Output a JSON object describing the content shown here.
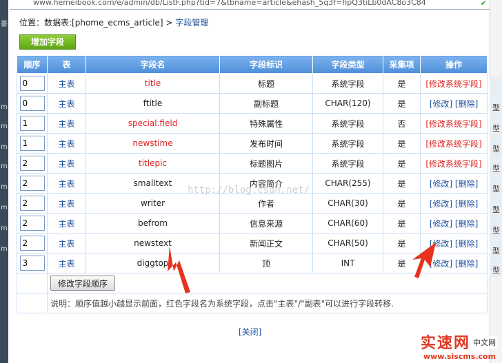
{
  "address_bar": {
    "url": "www.hemeibook.com/e/admin/db/ListF.php?tid=7&tbname=article&ehash_5q3f=fipQ3tiLb0dAC8o3C84",
    "secure_icon": "check-shield-icon"
  },
  "breadcrumb": {
    "prefix": "位置：数据表:[phome_ecms_article] >",
    "current": "字段管理"
  },
  "add_field_button": "增加字段",
  "table": {
    "headers": [
      "顺序",
      "表",
      "字段名",
      "字段标识",
      "字段类型",
      "采集项",
      "操作"
    ],
    "rows": [
      {
        "order": "0",
        "table": "主表",
        "field": "title",
        "label": "标题",
        "type": "系统字段",
        "collect": "是",
        "actions": [
          "[修改系统字段]"
        ],
        "system": true
      },
      {
        "order": "0",
        "table": "主表",
        "field": "ftitle",
        "label": "副标题",
        "type": "CHAR(120)",
        "collect": "是",
        "actions": [
          "[修改]",
          "[删除]"
        ],
        "system": false
      },
      {
        "order": "1",
        "table": "主表",
        "field": "special.field",
        "label": "特殊属性",
        "type": "系统字段",
        "collect": "否",
        "actions": [
          "[修改系统字段]"
        ],
        "system": true
      },
      {
        "order": "1",
        "table": "主表",
        "field": "newstime",
        "label": "发布时间",
        "type": "系统字段",
        "collect": "是",
        "actions": [
          "[修改系统字段]"
        ],
        "system": true
      },
      {
        "order": "2",
        "table": "主表",
        "field": "titlepic",
        "label": "标题图片",
        "type": "系统字段",
        "collect": "是",
        "actions": [
          "[修改系统字段]"
        ],
        "system": true
      },
      {
        "order": "2",
        "table": "主表",
        "field": "smalltext",
        "label": "内容简介",
        "type": "CHAR(255)",
        "collect": "是",
        "actions": [
          "[修改]",
          "[删除]"
        ],
        "system": false
      },
      {
        "order": "2",
        "table": "主表",
        "field": "writer",
        "label": "作者",
        "type": "CHAR(30)",
        "collect": "是",
        "actions": [
          "[修改]",
          "[删除]"
        ],
        "system": false
      },
      {
        "order": "2",
        "table": "主表",
        "field": "befrom",
        "label": "信息来源",
        "type": "CHAR(60)",
        "collect": "是",
        "actions": [
          "[修改]",
          "[删除]"
        ],
        "system": false
      },
      {
        "order": "2",
        "table": "主表",
        "field": "newstext",
        "label": "新闻正文",
        "type": "CHAR(50)",
        "collect": "是",
        "actions": [
          "[修改]",
          "[删除]"
        ],
        "system": false
      },
      {
        "order": "3",
        "table": "主表",
        "field": "diggtop",
        "label": "顶",
        "type": "INT",
        "collect": "是",
        "actions": [
          "[修改]",
          "[删除]"
        ],
        "system": false
      }
    ]
  },
  "modify_order_button": "修改字段顺序",
  "note": "说明：顺序值越小越显示前面，红色字段名为系统字段，点击\"主表\"/\"副表\"可以进行字段转移.",
  "close_link": "[关闭]",
  "watermark": "http://blog.csdn.net/",
  "brand": {
    "name": "实速网",
    "url": "www.siscms.com",
    "sub": "中文网"
  },
  "colors": {
    "header_blue": "#4d8fd9",
    "system_red": "#dd2222",
    "link_blue": "#1c4f9c",
    "add_green": "#6bb31f",
    "arrow_red": "#e8321e"
  }
}
